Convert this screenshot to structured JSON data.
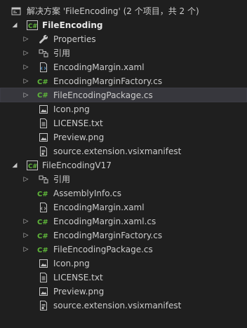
{
  "solution": {
    "label": "解决方案 'FileEncoding' (2 个项目，共 2 个)",
    "icon": "solution-icon"
  },
  "projects": [
    {
      "name": "FileEncoding",
      "icon": "csharp-project-icon",
      "expanded": true,
      "items": [
        {
          "label": "Properties",
          "icon": "wrench-icon",
          "expandable": true
        },
        {
          "label": "引用",
          "icon": "references-icon",
          "expandable": true
        },
        {
          "label": "EncodingMargin.xaml",
          "icon": "xaml-file-icon",
          "expandable": true
        },
        {
          "label": "EncodingMarginFactory.cs",
          "icon": "csharp-file-icon",
          "expandable": true
        },
        {
          "label": "FileEncodingPackage.cs",
          "icon": "csharp-file-icon",
          "expandable": true,
          "selected": true
        },
        {
          "label": "Icon.png",
          "icon": "image-file-icon",
          "expandable": false
        },
        {
          "label": "LICENSE.txt",
          "icon": "text-file-icon",
          "expandable": false
        },
        {
          "label": "Preview.png",
          "icon": "image-file-icon",
          "expandable": false
        },
        {
          "label": "source.extension.vsixmanifest",
          "icon": "manifest-file-icon",
          "expandable": false
        }
      ]
    },
    {
      "name": "FileEncodingV17",
      "icon": "csharp-project-icon",
      "expanded": true,
      "items": [
        {
          "label": "引用",
          "icon": "references-icon",
          "expandable": true
        },
        {
          "label": "AssemblyInfo.cs",
          "icon": "csharp-file-icon",
          "expandable": false
        },
        {
          "label": "EncodingMargin.xaml",
          "icon": "xaml-file-icon",
          "expandable": false
        },
        {
          "label": "EncodingMargin.xaml.cs",
          "icon": "csharp-file-icon",
          "expandable": true
        },
        {
          "label": "EncodingMarginFactory.cs",
          "icon": "csharp-file-icon",
          "expandable": true
        },
        {
          "label": "FileEncodingPackage.cs",
          "icon": "csharp-file-icon",
          "expandable": true
        },
        {
          "label": "Icon.png",
          "icon": "image-file-icon",
          "expandable": false
        },
        {
          "label": "LICENSE.txt",
          "icon": "text-file-icon",
          "expandable": false
        },
        {
          "label": "Preview.png",
          "icon": "image-file-icon",
          "expandable": false
        },
        {
          "label": "source.extension.vsixmanifest",
          "icon": "manifest-file-icon",
          "expandable": false
        }
      ]
    }
  ],
  "colors": {
    "background": "#1f1f1f",
    "selected_row": "#37373d",
    "csharp_green": "#5fb83a",
    "text": "#cccccc"
  }
}
